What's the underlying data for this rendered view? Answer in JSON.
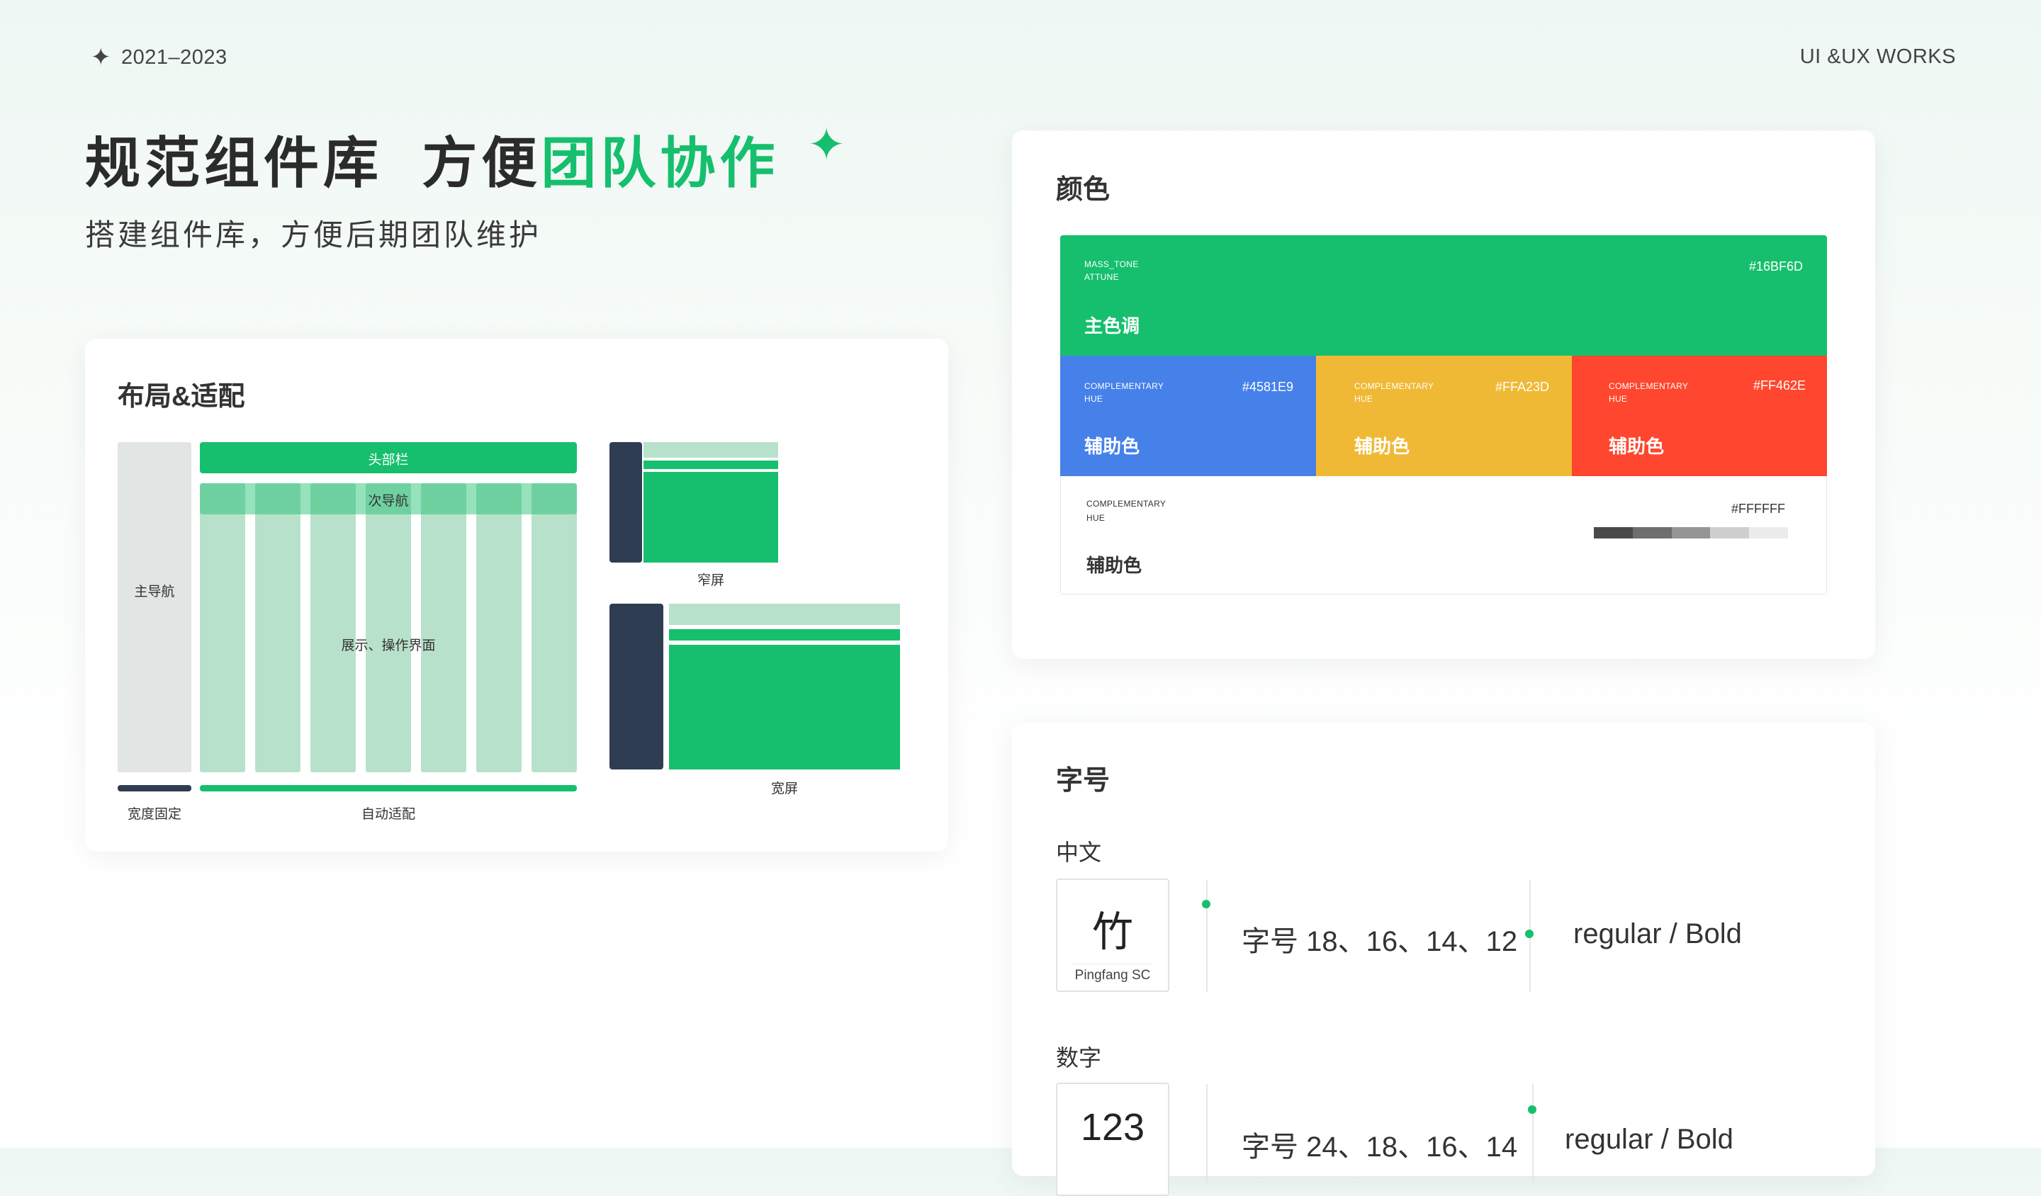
{
  "header": {
    "years": "2021–2023",
    "brand": "UI &UX WORKS"
  },
  "hero": {
    "title_part1": "规范组件库  方便",
    "title_accent": "团队协作",
    "subtitle": "搭建组件库，方便后期团队维护"
  },
  "layout_card": {
    "title": "布局&适配",
    "main_nav": "主导航",
    "header_bar": "头部栏",
    "sub_nav": "次导航",
    "content": "展示、操作界面",
    "fixed_width": "宽度固定",
    "auto_fit": "自动适配",
    "narrow": "窄屏",
    "wide": "宽屏"
  },
  "color_card": {
    "title": "颜色",
    "primary": {
      "tag1": "MASS_TONE",
      "tag2": "ATTUNE",
      "hex": "#16BF6D",
      "name": "主色调"
    },
    "secondary": [
      {
        "tag1": "COMPLEMENTARY",
        "tag2": "HUE",
        "hex": "#4581E9",
        "name": "辅助色"
      },
      {
        "tag1": "COMPLEMENTARY",
        "tag2": "HUE",
        "hex": "#FFA23D",
        "name": "辅助色"
      },
      {
        "tag1": "COMPLEMENTARY",
        "tag2": "HUE",
        "hex": "#FF462E",
        "name": "辅助色"
      }
    ],
    "neutral": {
      "tag1": "COMPLEMENTARY",
      "tag2": "HUE",
      "hex": "#FFFFFF",
      "name": "辅助色"
    },
    "colors": {
      "primary": "#16BF6D",
      "blue": "#4581E9",
      "yellow": "#F0B935",
      "red": "#FF462E",
      "grays": [
        "#4a4a4a",
        "#6e6e6e",
        "#959595",
        "#cfcfcf",
        "#ececec"
      ]
    }
  },
  "font_card": {
    "title": "字号",
    "chinese": {
      "label": "中文",
      "glyph": "竹",
      "font_name": "Pingfang SC",
      "sizes": "字号  18、16、14、12",
      "weights": "regular /   Bold"
    },
    "numbers": {
      "label": "数字",
      "glyph": "123",
      "sizes": "字号  24、18、16、14",
      "weights": "regular /   Bold"
    }
  }
}
